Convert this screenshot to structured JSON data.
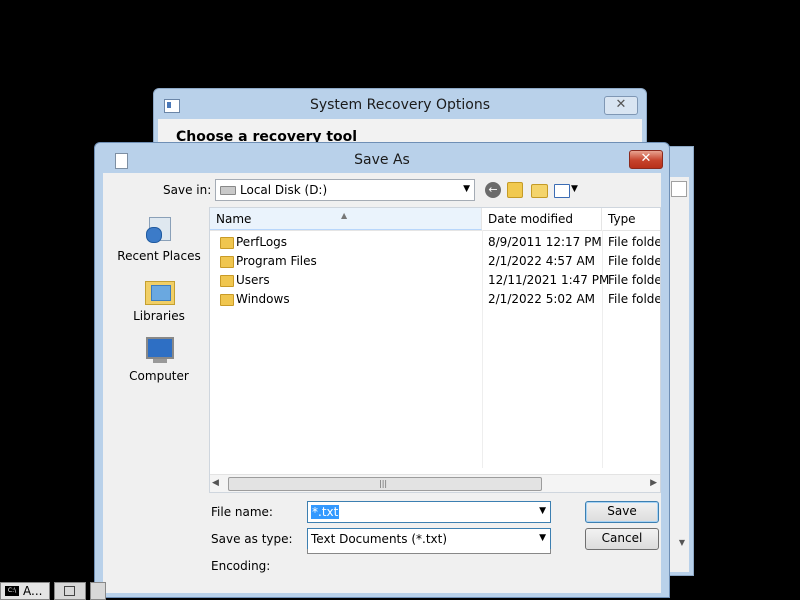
{
  "background_window": {
    "title": "System Recovery Options",
    "heading": "Choose a recovery tool",
    "close_glyph": "✕"
  },
  "dialog": {
    "title": "Save As",
    "close_glyph": "✕",
    "save_in_label": "Save in:",
    "save_in_value": "Local Disk (D:)",
    "places": [
      {
        "label": "Recent Places",
        "icon": "recent-places-icon"
      },
      {
        "label": "Libraries",
        "icon": "libraries-icon"
      },
      {
        "label": "Computer",
        "icon": "computer-icon"
      }
    ],
    "columns": {
      "name": "Name",
      "date": "Date modified",
      "type": "Type"
    },
    "files": [
      {
        "name": "PerfLogs",
        "date": "8/9/2011 12:17 PM",
        "type": "File folder"
      },
      {
        "name": "Program Files",
        "date": "2/1/2022 4:57 AM",
        "type": "File folder"
      },
      {
        "name": "Users",
        "date": "12/11/2021 1:47 PM",
        "type": "File folder"
      },
      {
        "name": "Windows",
        "date": "2/1/2022 5:02 AM",
        "type": "File folder"
      }
    ],
    "file_name_label": "File name:",
    "file_name_value": "*.txt",
    "save_as_type_label": "Save as type:",
    "save_as_type_value": "Text Documents (*.txt)",
    "encoding_label": "Encoding:",
    "save_button": "Save",
    "cancel_button": "Cancel"
  },
  "taskbar": {
    "cmd_item": "A..."
  }
}
